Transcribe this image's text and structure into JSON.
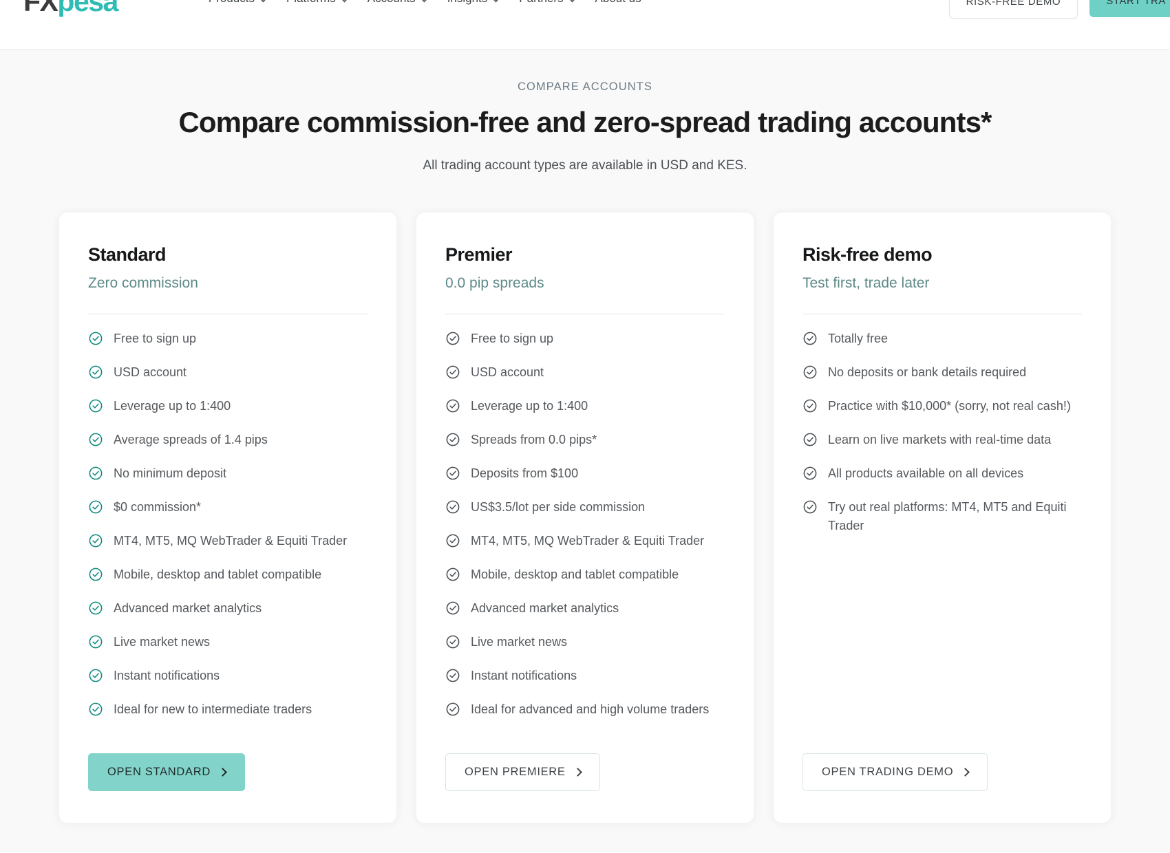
{
  "brand": {
    "name_part1": "FX",
    "name_part2": "pesa",
    "accent": "#2ebcb4"
  },
  "nav": {
    "items": [
      {
        "label": "Products",
        "has_chevron": true
      },
      {
        "label": "Platforms",
        "has_chevron": true
      },
      {
        "label": "Accounts",
        "has_chevron": true
      },
      {
        "label": "Insights",
        "has_chevron": true
      },
      {
        "label": "Partners",
        "has_chevron": true
      },
      {
        "label": "About us",
        "has_chevron": false
      }
    ],
    "demo_button": "RISK-FREE DEMO",
    "start_button": "START TRA"
  },
  "hero": {
    "eyebrow": "COMPARE ACCOUNTS",
    "headline": "Compare commission-free and zero-spread trading accounts*",
    "subhead": "All trading account types are available in USD and KES."
  },
  "cards": [
    {
      "title": "Standard",
      "subtitle": "Zero commission",
      "check_color": "#0f8a7e",
      "features": [
        "Free to sign up",
        "USD account",
        "Leverage up to 1:400",
        "Average spreads of 1.4 pips",
        "No minimum deposit",
        "$0 commission*",
        "MT4, MT5, MQ WebTrader & Equiti Trader",
        "Mobile, desktop and tablet compatible",
        "Advanced market analytics",
        "Live market news",
        "Instant notifications",
        "Ideal for new to intermediate traders"
      ],
      "cta_label": "OPEN STANDARD",
      "cta_style": "filled"
    },
    {
      "title": "Premier",
      "subtitle": "0.0 pip spreads",
      "check_color": "#4a4f53",
      "features": [
        "Free to sign up",
        "USD account",
        "Leverage up to 1:400",
        "Spreads from 0.0 pips*",
        "Deposits from $100",
        "US$3.5/lot per side commission",
        "MT4, MT5, MQ WebTrader & Equiti Trader",
        "Mobile, desktop and tablet compatible",
        "Advanced market analytics",
        "Live market news",
        "Instant notifications",
        "Ideal for advanced and high volume traders"
      ],
      "cta_label": "OPEN PREMIERE",
      "cta_style": "outline"
    },
    {
      "title": "Risk-free demo",
      "subtitle": "Test first, trade later",
      "check_color": "#4a4f53",
      "features": [
        "Totally free",
        "No deposits or bank details required",
        "Practice with $10,000* (sorry, not real cash!)",
        "Learn on live markets with real-time data",
        "All products available on all devices",
        "Try out real platforms: MT4, MT5 and Equiti Trader"
      ],
      "cta_label": "OPEN TRADING DEMO",
      "cta_style": "outline"
    }
  ]
}
